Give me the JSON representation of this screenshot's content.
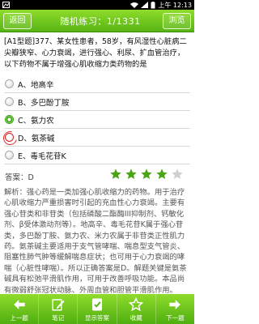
{
  "status_bar": {
    "time": "上午 12:13"
  },
  "header": {
    "back_label": "返回",
    "title": "随机练习：1/1331",
    "browse_label": "浏览"
  },
  "question": {
    "text": "[A1型题]377、某女性患者，58岁，有风湿性心脏病二尖瓣狭窄、心力衰竭，进行强心、利尿、扩血管治疗，以下药物不属于增强心肌收缩力类药物的是"
  },
  "options": [
    {
      "label": "A、地高辛",
      "state": "none"
    },
    {
      "label": "B、多巴酚丁胺",
      "state": "none"
    },
    {
      "label": "C、氨力农",
      "state": "correct"
    },
    {
      "label": "D、氨茶碱",
      "state": "wrong"
    },
    {
      "label": "E、毒毛花苷K",
      "state": "none"
    }
  ],
  "answer": {
    "text": "答案：D"
  },
  "rating": {
    "filled": 4,
    "total": 5
  },
  "explanation": {
    "text": "解析：强心药是一类加强心肌收缩力的药物。用于治疗心肌收缩力严重损害时引起的充血性心力衰竭。主要有强心苷类和非苷类（包括磷酸二酯酶III抑制剂、钙敏化剂、β受体激动剂等）。地高辛、毒毛花苷K属于强心苷类，多巴酚丁胺、氨力农、米力农属于非苷类正性肌力药。氨茶碱主要适用于支气管哮喘、喘息型支气管炎、阻塞性肺气肿等缓解喘息症状；也可用于心力衰竭的哮喘（心脏性哮喘）。所以正确答案是D。解题关键是氨茶碱具有松弛平滑肌作用，可用于改善呼吸功能。本品尚有微弱舒张冠状动脉、外周血管和胆管平滑肌作用。"
  },
  "toolbar": {
    "items": [
      {
        "label": "上一题"
      },
      {
        "label": "笔记"
      },
      {
        "label": "显示答案"
      },
      {
        "label": "收藏"
      },
      {
        "label": "下一题"
      }
    ]
  },
  "colors": {
    "accent": "#56b414",
    "star": "#4aa514",
    "wrong": "#e02b2b"
  }
}
